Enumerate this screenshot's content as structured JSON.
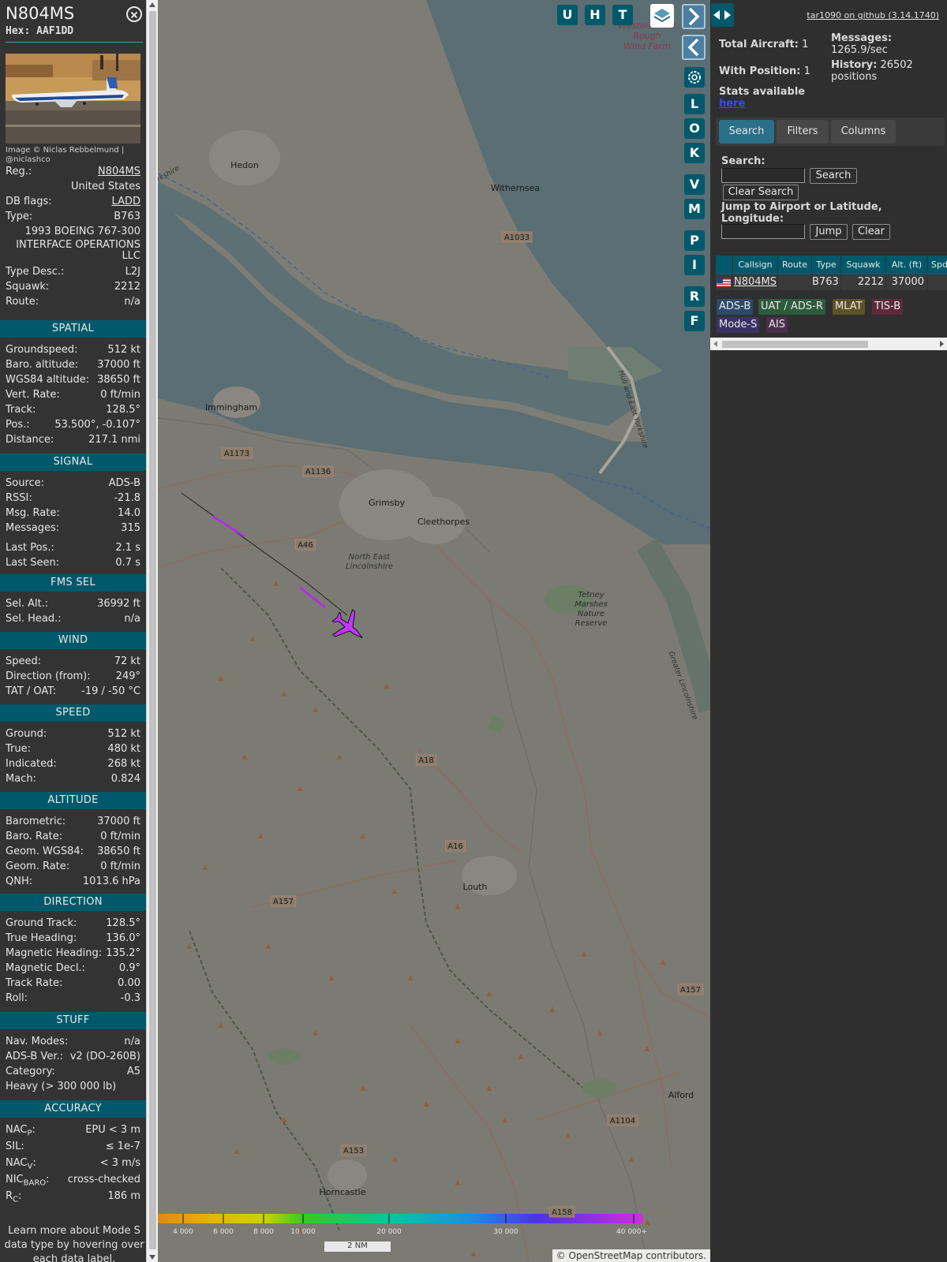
{
  "header": {
    "registration": "N804MS",
    "hex_label": "Hex:",
    "hex": "AAF1DD"
  },
  "photo": {
    "credit": "Image © Niclas Rebbelmund | @niclashco"
  },
  "info": [
    {
      "key": "Reg.:",
      "value": "N804MS"
    },
    {
      "key": "",
      "value": "United States"
    },
    {
      "key": "DB flags:",
      "value": "LADD"
    },
    {
      "key": "Type:",
      "value": "B763"
    },
    {
      "key": "",
      "value": "1993 BOEING 767-300"
    },
    {
      "key": "",
      "value": "INTERFACE OPERATIONS LLC"
    },
    {
      "key": "Type Desc.:",
      "value": "L2J"
    },
    {
      "key": "Squawk:",
      "value": "2212"
    },
    {
      "key": "Route:",
      "value": "n/a"
    }
  ],
  "spatial": {
    "title": "SPATIAL",
    "rows": [
      {
        "key": "Groundspeed:",
        "value": "512 kt"
      },
      {
        "key": "Baro. altitude:",
        "value": "37000 ft"
      },
      {
        "key": "WGS84 altitude:",
        "value": "38650 ft"
      },
      {
        "key": "Vert. Rate:",
        "value": "0 ft/min"
      },
      {
        "key": "Track:",
        "value": "128.5°"
      },
      {
        "key": "Pos.:",
        "value": "53.500°, -0.107°"
      },
      {
        "key": "Distance:",
        "value": "217.1 nmi"
      }
    ]
  },
  "signal": {
    "title": "SIGNAL",
    "rows": [
      {
        "key": "Source:",
        "value": "ADS-B"
      },
      {
        "key": "RSSI:",
        "value": "-21.8"
      },
      {
        "key": "Msg. Rate:",
        "value": "14.0"
      },
      {
        "key": "Messages:",
        "value": "315"
      },
      {
        "key": "Last Pos.:",
        "value": "2.1 s"
      },
      {
        "key": "Last Seen:",
        "value": "0.7 s"
      }
    ]
  },
  "fms": {
    "title": "FMS SEL",
    "rows": [
      {
        "key": "Sel. Alt.:",
        "value": "36992 ft"
      },
      {
        "key": "Sel. Head.:",
        "value": "n/a"
      }
    ]
  },
  "wind": {
    "title": "WIND",
    "rows": [
      {
        "key": "Speed:",
        "value": "72 kt"
      },
      {
        "key": "Direction (from):",
        "value": "249°"
      },
      {
        "key": "TAT / OAT:",
        "value": "-19 / -50 °C"
      }
    ]
  },
  "speed": {
    "title": "SPEED",
    "rows": [
      {
        "key": "Ground:",
        "value": "512 kt"
      },
      {
        "key": "True:",
        "value": "480 kt"
      },
      {
        "key": "Indicated:",
        "value": "268 kt"
      },
      {
        "key": "Mach:",
        "value": "0.824"
      }
    ]
  },
  "altitude": {
    "title": "ALTITUDE",
    "rows": [
      {
        "key": "Barometric:",
        "value": "37000 ft"
      },
      {
        "key": "Baro. Rate:",
        "value": "0 ft/min"
      },
      {
        "key": "Geom. WGS84:",
        "value": "38650 ft"
      },
      {
        "key": "Geom. Rate:",
        "value": "0 ft/min"
      },
      {
        "key": "QNH:",
        "value": "1013.6 hPa"
      }
    ]
  },
  "direction": {
    "title": "DIRECTION",
    "rows": [
      {
        "key": "Ground Track:",
        "value": "128.5°"
      },
      {
        "key": "True Heading:",
        "value": "136.0°"
      },
      {
        "key": "Magnetic Heading:",
        "value": "135.2°"
      },
      {
        "key": "Magnetic Decl.:",
        "value": "0.9°"
      },
      {
        "key": "Track Rate:",
        "value": "0.00"
      },
      {
        "key": "Roll:",
        "value": "-0.3"
      }
    ]
  },
  "stuff": {
    "title": "STUFF",
    "rows": [
      {
        "key": "Nav. Modes:",
        "value": "n/a"
      },
      {
        "key": "ADS-B Ver.:",
        "value": "v2 (DO-260B)"
      },
      {
        "key": "Category:",
        "value": "A5"
      },
      {
        "key": "Heavy (> 300 000 lb)",
        "value": ""
      }
    ]
  },
  "accuracy": {
    "title": "ACCURACY",
    "rows": [
      {
        "key": "NACP:",
        "value": "EPU < 3 m"
      },
      {
        "key": "SIL:",
        "value": "≤ 1e-7"
      },
      {
        "key": "NACV:",
        "value": "< 3 m/s"
      },
      {
        "key": "NICBARO:",
        "value": "cross-checked"
      },
      {
        "key": "RC:",
        "value": "186 m"
      }
    ]
  },
  "learn_more": "Learn more about Mode S data type by hovering over each data label.",
  "map": {
    "labels": [
      {
        "text": "Westernmost Rough Wind Farm"
      },
      {
        "text": "Hedon"
      },
      {
        "text": "Withernsea"
      },
      {
        "text": "A1033"
      },
      {
        "text": "Immingham"
      },
      {
        "text": "A1173"
      },
      {
        "text": "A1136"
      },
      {
        "text": "Grimsby"
      },
      {
        "text": "Cleethorpes"
      },
      {
        "text": "A46"
      },
      {
        "text": "North East Lincolnshire"
      },
      {
        "text": "Tetney Marshes Nature Reserve"
      },
      {
        "text": "A18"
      },
      {
        "text": "A16"
      },
      {
        "text": "Louth"
      },
      {
        "text": "A157"
      },
      {
        "text": "A157"
      },
      {
        "text": "Alford"
      },
      {
        "text": "A1104"
      },
      {
        "text": "A153"
      },
      {
        "text": "Horncastle"
      },
      {
        "text": "A158"
      },
      {
        "text": "Hull and East Yorkshire"
      },
      {
        "text": "Greater Lincolnshire"
      },
      {
        "text": "Yorkshire"
      }
    ],
    "buttons": [
      "U",
      "H",
      "T"
    ],
    "side_buttons": [
      "L",
      "O",
      "K",
      "V",
      "M",
      "P",
      "I",
      "R",
      "F"
    ],
    "altitude_scale": [
      "4 000",
      "6 000",
      "8 000",
      "10 000",
      "20 000",
      "30 000",
      "40 000+"
    ],
    "scale_bar": "2 NM",
    "attribution": "© OpenStreetMap contributors."
  },
  "right": {
    "github": "tar1090 on github (3.14.1740)",
    "total_label": "Total Aircraft:",
    "total": "1",
    "with_pos_label": "With Position:",
    "with_pos": "1",
    "messages_label": "Messages:",
    "messages": "1265.9/sec",
    "history_label": "History:",
    "history": "26502 positions",
    "stats_label": "Stats available",
    "stats_link": "here",
    "tabs": [
      "Search",
      "Filters",
      "Columns"
    ],
    "search_label": "Search:",
    "search_btn": "Search",
    "clear_search_btn": "Clear Search",
    "jump_label": "Jump to Airport or Latitude, Longitude:",
    "jump_btn": "Jump",
    "clear_btn": "Clear",
    "columns": [
      "Callsign",
      "Route",
      "Type",
      "Squawk",
      "Alt. (ft)",
      "Spd."
    ],
    "aircraft": {
      "callsign": "N804MS",
      "route": "",
      "type": "B763",
      "squawk": "2212",
      "alt": "37000"
    },
    "sources": [
      {
        "label": "ADS-B",
        "bg": "#2d4a6b"
      },
      {
        "label": "UAT / ADS-R",
        "bg": "#2e5a3e"
      },
      {
        "label": "MLAT",
        "bg": "#5e5326"
      },
      {
        "label": "TIS-B",
        "bg": "#5e2a3b"
      },
      {
        "label": "Mode-S",
        "bg": "#3b3264"
      },
      {
        "label": "AIS",
        "bg": "#4a2f4e"
      }
    ]
  }
}
